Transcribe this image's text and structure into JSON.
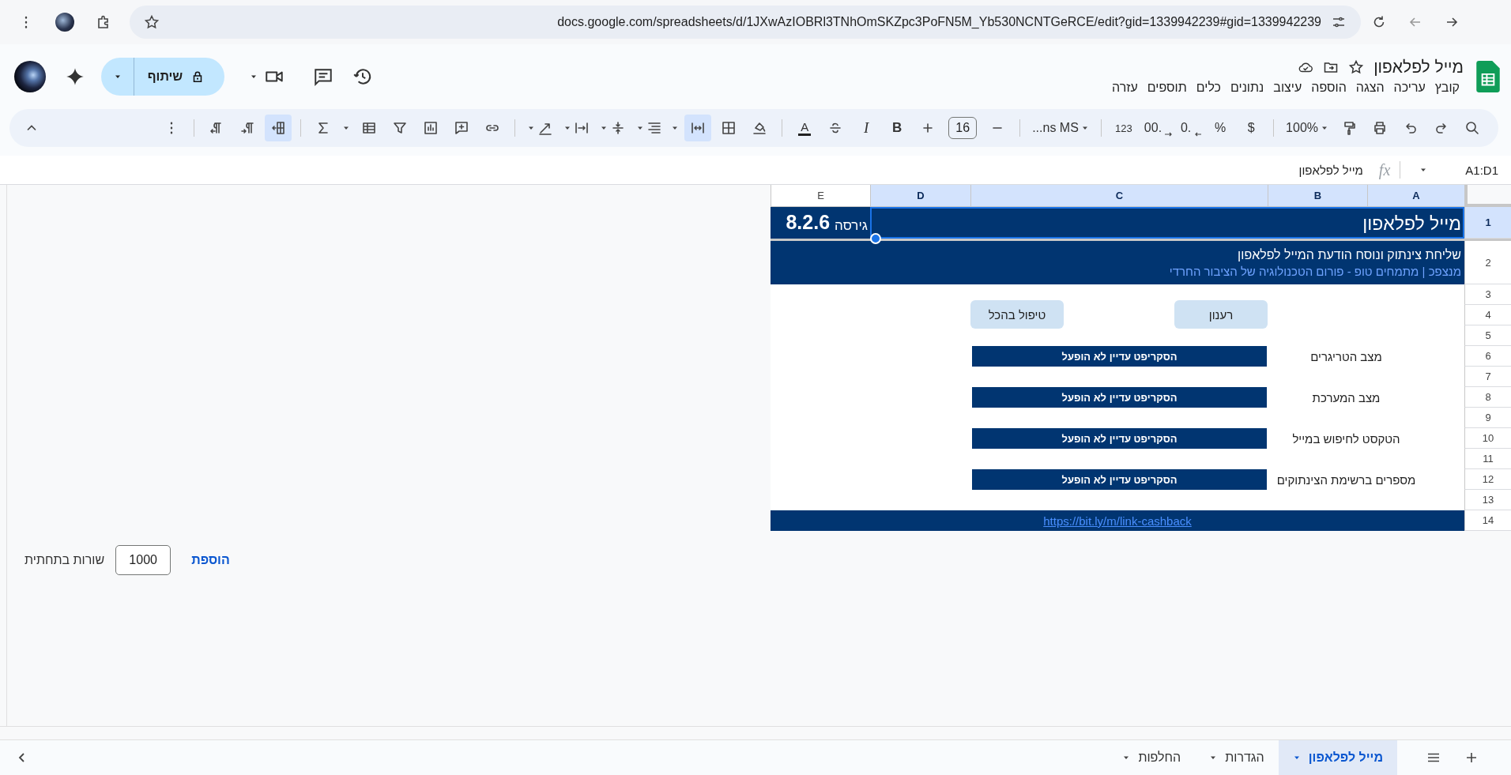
{
  "browser": {
    "url": "docs.google.com/spreadsheets/d/1JXwAzIOBRl3TNhOmSKZpc3PoFN5M_Yb530NCNTGeRCE/edit?gid=1339942239#gid=1339942239"
  },
  "document": {
    "title": "מייל לפלאפון",
    "menu": [
      "קובץ",
      "עריכה",
      "הצגה",
      "הוספה",
      "עיצוב",
      "נתונים",
      "כלים",
      "תוספים",
      "עזרה"
    ],
    "share": "שיתוף"
  },
  "toolbar": {
    "zoom": "100%",
    "currency": "$",
    "percent": "%",
    "decrease_decimals": ".0",
    "increase_decimals": ".00",
    "more_formats": "123",
    "font": "...ns MS",
    "font_size": "16",
    "bold": "B",
    "italic": "I",
    "text_color": "A",
    "merge_on": true,
    "rtl_on": true
  },
  "formula_bar": {
    "name_box": "A1:D1",
    "fx": "fx",
    "formula": "מייל לפלאפון"
  },
  "sheet": {
    "columns": [
      {
        "label": "A",
        "selected": true
      },
      {
        "label": "B",
        "selected": true
      },
      {
        "label": "C",
        "selected": true
      },
      {
        "label": "D",
        "selected": true
      },
      {
        "label": "E",
        "selected": false
      }
    ],
    "rows": [
      {
        "number": "1",
        "selected": true
      },
      {
        "number": "2",
        "selected": false
      },
      {
        "number": "3",
        "selected": false
      },
      {
        "number": "4",
        "selected": false
      },
      {
        "number": "5",
        "selected": false
      },
      {
        "number": "6",
        "selected": false
      },
      {
        "number": "7",
        "selected": false
      },
      {
        "number": "8",
        "selected": false
      },
      {
        "number": "9",
        "selected": false
      },
      {
        "number": "10",
        "selected": false
      },
      {
        "number": "11",
        "selected": false
      },
      {
        "number": "12",
        "selected": false
      },
      {
        "number": "13",
        "selected": false
      },
      {
        "number": "14",
        "selected": false
      }
    ],
    "title": "מייל לפלאפון",
    "version_label": "גירסה",
    "version": "8.2.6",
    "subtitle": "שליחת צינתוק ונוסח הודעת המייל לפלאפון",
    "credit": "מנצפכ | מתמחים טופ - פורום הטכנולוגיה של הציבור החרדי",
    "buttons": [
      "רענון",
      "טיפול בהכל"
    ],
    "status_rows": [
      {
        "label": "מצב הטריגרים",
        "value": "הסקריפט עדיין לא הופעל"
      },
      {
        "label": "מצב המערכת",
        "value": "הסקריפט עדיין לא הופעל"
      },
      {
        "label": "הטקסט לחיפוש במייל",
        "value": "הסקריפט עדיין לא הופעל"
      },
      {
        "label": "מספרים ברשימת הצינתוקים",
        "value": "הסקריפט עדיין לא הופעל"
      }
    ],
    "link": "https://bit.ly/m/link-cashback"
  },
  "add_rows": {
    "button": "הוספת",
    "count": "1000",
    "label": "שורות בתחתית"
  },
  "sheet_tabs": [
    {
      "label": "מייל לפלאפון",
      "selected": true
    },
    {
      "label": "הגדרות",
      "selected": false
    },
    {
      "label": "החלפות",
      "selected": false
    }
  ]
}
